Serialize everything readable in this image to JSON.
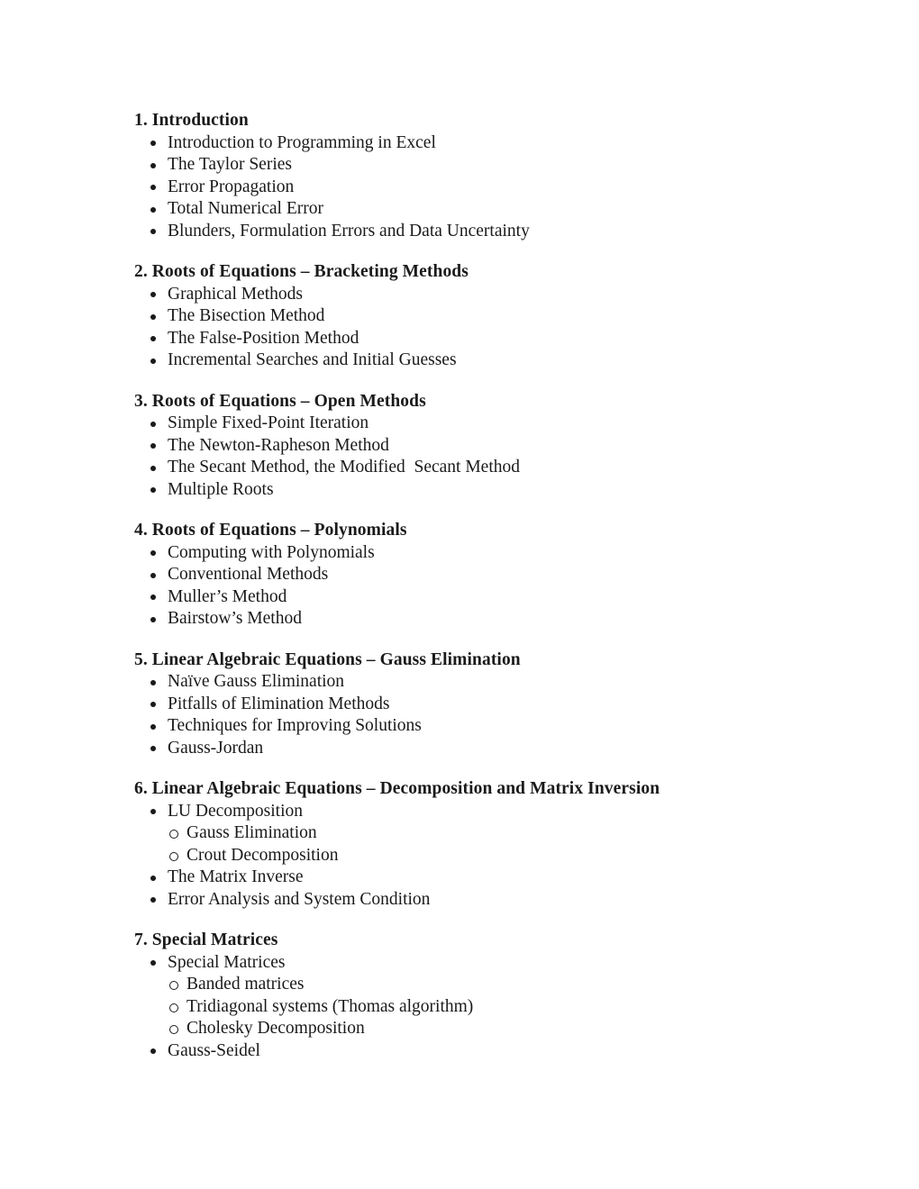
{
  "document": {
    "text_color": "#1a1a1a",
    "background_color": "#ffffff",
    "sections": [
      {
        "heading": "1. Introduction",
        "items": [
          {
            "label": "Introduction to Programming in Excel"
          },
          {
            "label": "The Taylor Series"
          },
          {
            "label": "Error Propagation"
          },
          {
            "label": "Total Numerical Error"
          },
          {
            "label": "Blunders, Formulation Errors and Data Uncertainty"
          }
        ]
      },
      {
        "heading": "2. Roots of Equations – Bracketing Methods",
        "items": [
          {
            "label": "Graphical Methods"
          },
          {
            "label": "The Bisection Method"
          },
          {
            "label": "The False-Position Method"
          },
          {
            "label": "Incremental Searches and Initial Guesses"
          }
        ]
      },
      {
        "heading": "3. Roots of Equations – Open Methods",
        "items": [
          {
            "label": "Simple Fixed-Point Iteration"
          },
          {
            "label": "The Newton-Rapheson Method"
          },
          {
            "label": "The Secant Method, the Modified  Secant Method"
          },
          {
            "label": "Multiple Roots"
          }
        ]
      },
      {
        "heading": "4. Roots of Equations – Polynomials",
        "items": [
          {
            "label": "Computing with Polynomials"
          },
          {
            "label": "Conventional Methods"
          },
          {
            "label": "Muller’s Method"
          },
          {
            "label": "Bairstow’s Method"
          }
        ]
      },
      {
        "heading": "5. Linear Algebraic Equations – Gauss Elimination",
        "items": [
          {
            "label": "Naïve Gauss Elimination"
          },
          {
            "label": "Pitfalls of Elimination Methods"
          },
          {
            "label": "Techniques for Improving Solutions"
          },
          {
            "label": "Gauss-Jordan"
          }
        ]
      },
      {
        "heading": "6. Linear Algebraic Equations – Decomposition and Matrix Inversion",
        "items": [
          {
            "label": "LU Decomposition",
            "subitems": [
              {
                "label": "Gauss Elimination"
              },
              {
                "label": "Crout Decomposition"
              }
            ]
          },
          {
            "label": "The Matrix Inverse"
          },
          {
            "label": "Error Analysis and System Condition"
          }
        ]
      },
      {
        "heading": "7. Special Matrices",
        "items": [
          {
            "label": "Special Matrices",
            "subitems": [
              {
                "label": "Banded matrices"
              },
              {
                "label": "Tridiagonal systems (Thomas algorithm)"
              },
              {
                "label": "Cholesky Decomposition"
              }
            ]
          },
          {
            "label": "Gauss-Seidel"
          }
        ]
      }
    ]
  }
}
